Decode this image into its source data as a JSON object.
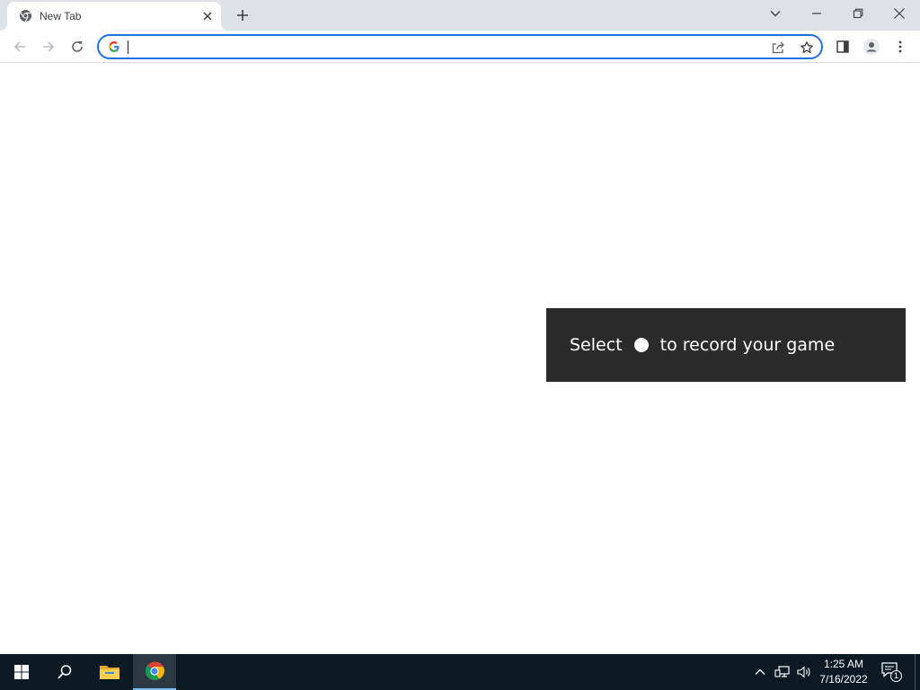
{
  "browser": {
    "tab": {
      "title": "New Tab",
      "favicon": "chrome-icon"
    },
    "window_controls": [
      "tab-search-icon",
      "minimize-icon",
      "restore-icon",
      "close-icon"
    ],
    "toolbar": {
      "back_icon": "arrow-left-icon",
      "forward_icon": "arrow-right-icon",
      "reload_icon": "reload-icon",
      "omnibox": {
        "value": "",
        "placeholder": "",
        "left_icon": "google-g-icon"
      },
      "omnibox_right_icons": [
        "share-icon",
        "star-icon"
      ],
      "right_icons": [
        "side-panel-icon",
        "profile-icon",
        "more-vert-icon"
      ]
    }
  },
  "toast": {
    "text_before": "Select",
    "text_after": "to record your game",
    "dot_icon": "record-dot-icon"
  },
  "taskbar": {
    "start_icon": "windows-start-icon",
    "search_icon": "search-icon",
    "apps": [
      "file-explorer-icon",
      "chrome-icon"
    ],
    "tray_icons": [
      "chevron-up-icon",
      "network-icon",
      "volume-icon"
    ],
    "clock": {
      "time": "1:25 AM",
      "date": "7/16/2022"
    },
    "notifications": {
      "icon": "action-center-icon",
      "count": "1"
    }
  },
  "colors": {
    "tabstrip_bg": "#dee1e6",
    "omnibox_focus": "#1a73e8",
    "toast_bg": "#2b2b2b",
    "taskbar_bg": "#0c1a24"
  }
}
